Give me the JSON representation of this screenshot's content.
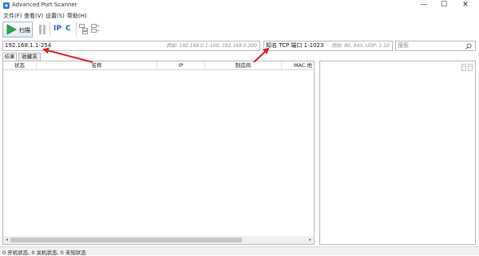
{
  "window": {
    "title": "Advanced Port Scanner",
    "minimize_glyph": "—",
    "maximize_glyph": "☐",
    "close_glyph": "✕"
  },
  "menu": {
    "items": [
      {
        "label": "文件(F)"
      },
      {
        "label": "查看(V)"
      },
      {
        "label": "设置(S)"
      },
      {
        "label": "帮助(H)"
      }
    ]
  },
  "toolbar": {
    "scan_label": "扫描",
    "pause_icon": "pause-icon",
    "ip_icon_text": "IP",
    "c_icon_text": "C"
  },
  "inputs": {
    "ip_range": {
      "value": "192.168.1.1-254",
      "hint": "例如: 192.168.0.1-100, 192.168.0.200"
    },
    "ports": {
      "value": "知名 TCP 端口 1-1023",
      "hint": "例如: 80, 443, UDP: 1-10"
    },
    "search": {
      "placeholder": "搜索"
    }
  },
  "tabs": [
    {
      "label": "结果",
      "active": true
    },
    {
      "label": "收藏夹",
      "active": false
    }
  ],
  "table": {
    "columns": [
      "状态",
      "名称",
      "IP",
      "制造商",
      "MAC 地"
    ]
  },
  "status": {
    "text": "0 开机状态, 0 关机状态, 0 未知状态"
  },
  "colors": {
    "accent_green": "#2fa84f",
    "annotation_red": "#d62020",
    "ip_blue": "#1e5fd0"
  }
}
